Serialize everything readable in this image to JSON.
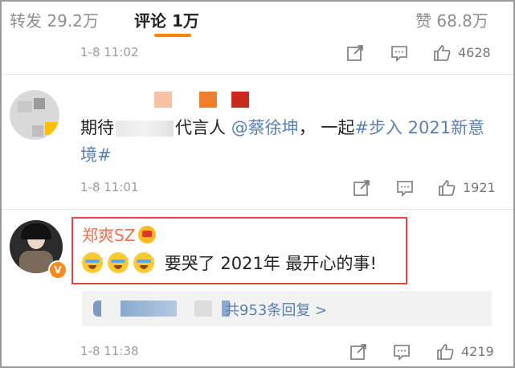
{
  "tabs": {
    "repost": "转发 29.2万",
    "comments": "评论 1万",
    "likes": "赞 68.8万",
    "active_color": "#ff8200"
  },
  "top_meta": {
    "time": "1-8 11:02",
    "like_count": "4628"
  },
  "comment1": {
    "text_prefix": "期待",
    "text_middle": "代言人",
    "mention": "@蔡徐坤",
    "text_after_mention": "， 一起",
    "hashtag": "#步入 2021新意境#",
    "time": "1-8 11:01",
    "like_count": "1921",
    "blur_colors": [
      "#f7c1a3",
      "#ef7d2b",
      "#c92a1e"
    ]
  },
  "comment2": {
    "username": "郑爽SZ",
    "text": "要哭了 2021年 最开心的事!",
    "reply_summary": "共953条回复 >",
    "time": "1-8 11:38",
    "like_count": "4219",
    "verified_badge": "V"
  },
  "icons": [
    "share-icon",
    "comment-icon",
    "like-icon"
  ],
  "colors": {
    "link": "#5a7fb5",
    "username": "#eb7350",
    "highlight_border": "#e14545"
  }
}
